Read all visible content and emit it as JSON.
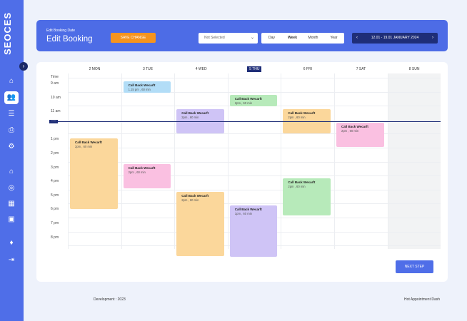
{
  "logo": "SEOCES",
  "header": {
    "subtitle": "Edit Booking Date",
    "title": "Edit Booking",
    "save_label": "SAVE CHANGE",
    "select_value": "Not Selected",
    "views": [
      "Day",
      "Week",
      "Month",
      "Year"
    ],
    "active_view": "Week",
    "date_range": "12.01 - 19.01 JANUARY 2024"
  },
  "calendar": {
    "time_label": "Time",
    "days": [
      "2 MON",
      "3 TUE",
      "4 WED",
      "5 THU",
      "6 FRI",
      "7 SAT",
      "8 SUN"
    ],
    "today": "5 THU",
    "times": [
      "9 am",
      "10 am",
      "11 am",
      "",
      "1 pm",
      "2 pm",
      "3 pm",
      "4 pm",
      "5 pm",
      "6 pm",
      "7 pm",
      "8 pm"
    ],
    "now_label": "12:00",
    "events": [
      {
        "day": 1,
        "title": "Call Back Wecarft",
        "sub": "1.15 pm , 60 min",
        "color": "#b2ddf7"
      },
      {
        "day": 3,
        "title": "Call Back Wecarft",
        "sub": "2pm , 60 min",
        "color": "#b7eaba"
      },
      {
        "day": 4,
        "title": "Call Back Wecarft",
        "sub": "2pm , 60 min",
        "color": "#fbd79b"
      },
      {
        "day": 2,
        "title": "Call Back Wecarft",
        "sub": "2pm , 60 min",
        "color": "#cfc4f6"
      },
      {
        "day": 5,
        "title": "Call Back Wecarft",
        "sub": "2pm , 60 min",
        "color": "#fac0e1"
      },
      {
        "day": 0,
        "title": "Call Back Wecarft",
        "sub": "2pm , 60 min",
        "color": "#fbd79b"
      },
      {
        "day": 1,
        "title": "Call Back Wecarft",
        "sub": "2pm , 60 min",
        "color": "#fac0e1"
      },
      {
        "day": 4,
        "title": "Call Back Wecarft",
        "sub": "2pm , 60 min",
        "color": "#b7eaba"
      },
      {
        "day": 2,
        "title": "Call Back Wecarft",
        "sub": "2pm , 60 min",
        "color": "#fbd79b"
      },
      {
        "day": 3,
        "title": "Call Back Wecarft",
        "sub": "1pm , 60 min",
        "color": "#cfc4f6"
      }
    ]
  },
  "next_label": "NEXT STEP",
  "footer": {
    "left": "Development : 2023",
    "right": "Hot Appointment Dash"
  }
}
